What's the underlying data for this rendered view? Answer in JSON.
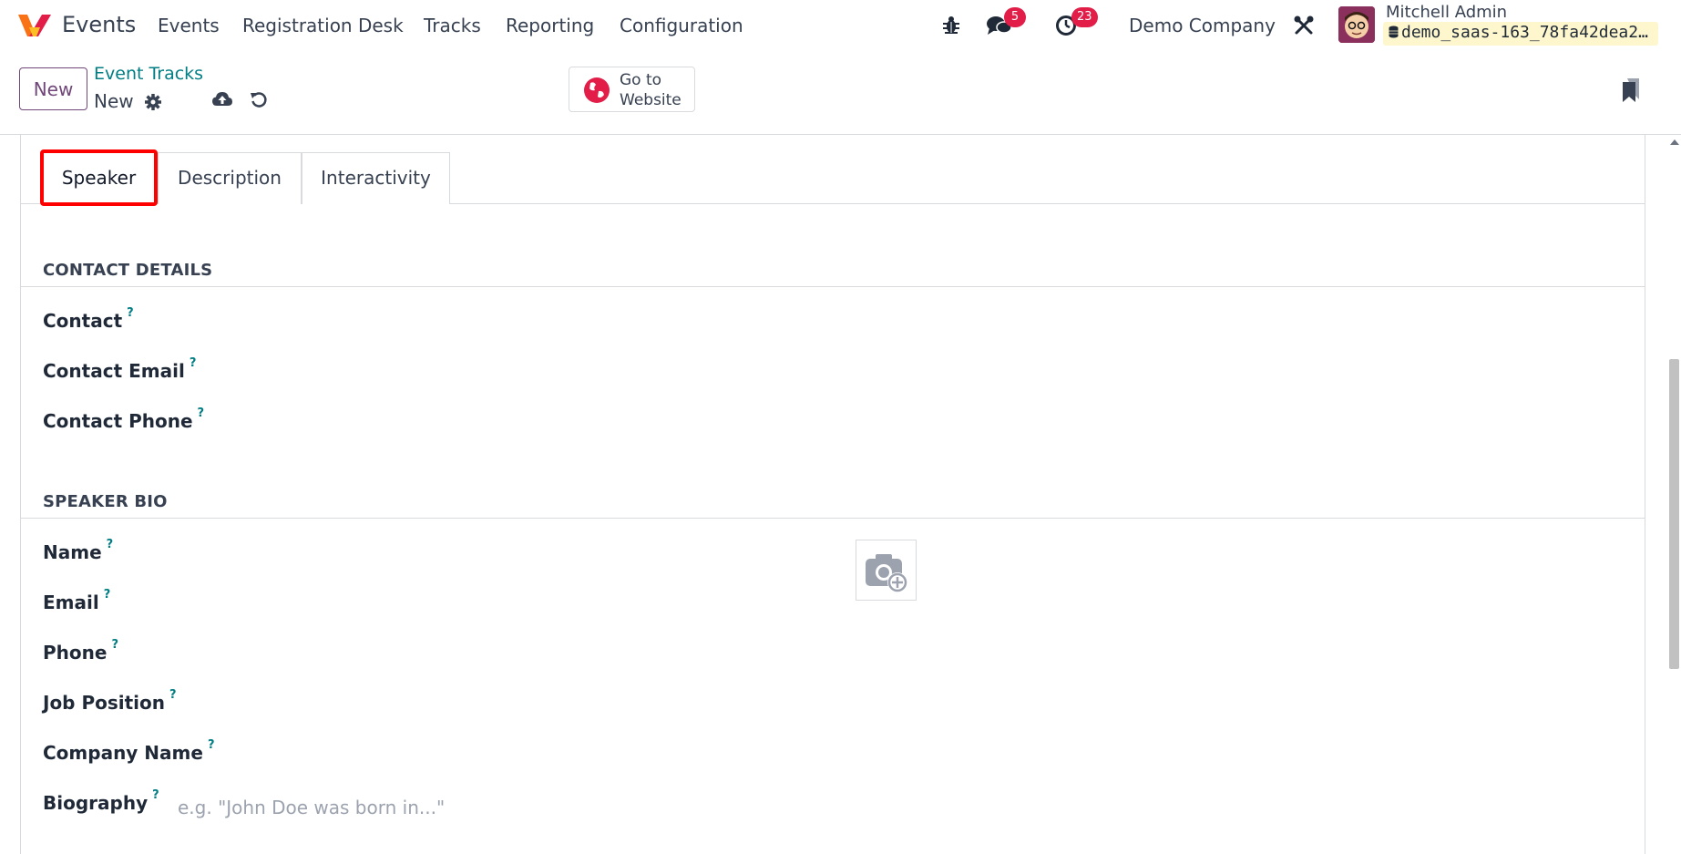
{
  "app": {
    "name": "Events"
  },
  "menu": [
    {
      "label": "Events"
    },
    {
      "label": "Registration Desk"
    },
    {
      "label": "Tracks"
    },
    {
      "label": "Reporting"
    },
    {
      "label": "Configuration"
    }
  ],
  "systray": {
    "messages_count": "5",
    "activities_count": "23",
    "company": "Demo Company",
    "user_name": "Mitchell Admin",
    "database": "demo_saas-163_78fa42dea2…"
  },
  "control_panel": {
    "new_button": "New",
    "breadcrumb": "Event Tracks",
    "record_name": "New",
    "go_to_website": "Go to Website"
  },
  "tabs": [
    {
      "label": "Speaker",
      "active": true
    },
    {
      "label": "Description",
      "active": false
    },
    {
      "label": "Interactivity",
      "active": false
    }
  ],
  "contact_section": {
    "title": "CONTACT DETAILS",
    "fields": [
      "Contact",
      "Contact Email",
      "Contact Phone"
    ]
  },
  "speaker_section": {
    "title": "SPEAKER BIO",
    "fields": [
      "Name",
      "Email",
      "Phone",
      "Job Position",
      "Company Name",
      "Biography"
    ],
    "biography_placeholder": "e.g. \"John Doe was born in...\""
  },
  "help_marker": "?",
  "colors": {
    "brand": "#71477a",
    "link": "#017e84",
    "badge": "#e11d48",
    "highlight": "#ff0000"
  }
}
